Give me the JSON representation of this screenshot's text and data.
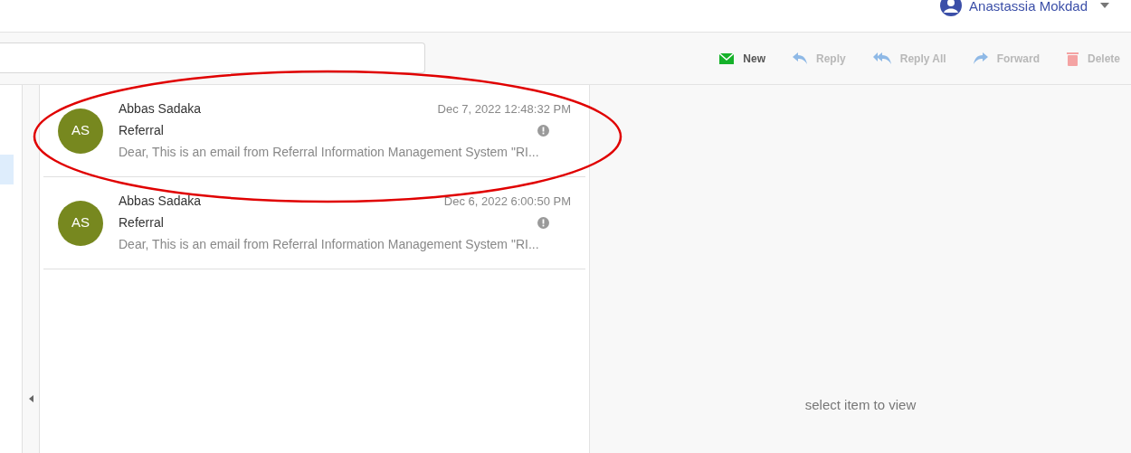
{
  "user": {
    "name": "Anastassia Mokdad"
  },
  "toolbar": [
    {
      "kind": "new",
      "label": "New",
      "disabled": false
    },
    {
      "kind": "reply",
      "label": "Reply",
      "disabled": true
    },
    {
      "kind": "reply_all",
      "label": "Reply All",
      "disabled": true
    },
    {
      "kind": "forward",
      "label": "Forward",
      "disabled": true
    },
    {
      "kind": "delete",
      "label": "Delete",
      "disabled": true
    }
  ],
  "messages": [
    {
      "initials": "AS",
      "sender": "Abbas Sadaka",
      "date": "Dec 7, 2022 12:48:32 PM",
      "subject": "Referral",
      "preview": "Dear, This is an email from Referral Information Management System \"RI...",
      "highlighted": true
    },
    {
      "initials": "AS",
      "sender": "Abbas Sadaka",
      "date": "Dec 6, 2022 6:00:50 PM",
      "subject": "Referral",
      "preview": "Dear, This is an email from Referral Information Management System \"RI...",
      "highlighted": false
    }
  ],
  "reading_pane": {
    "empty_message": "select item to view"
  }
}
